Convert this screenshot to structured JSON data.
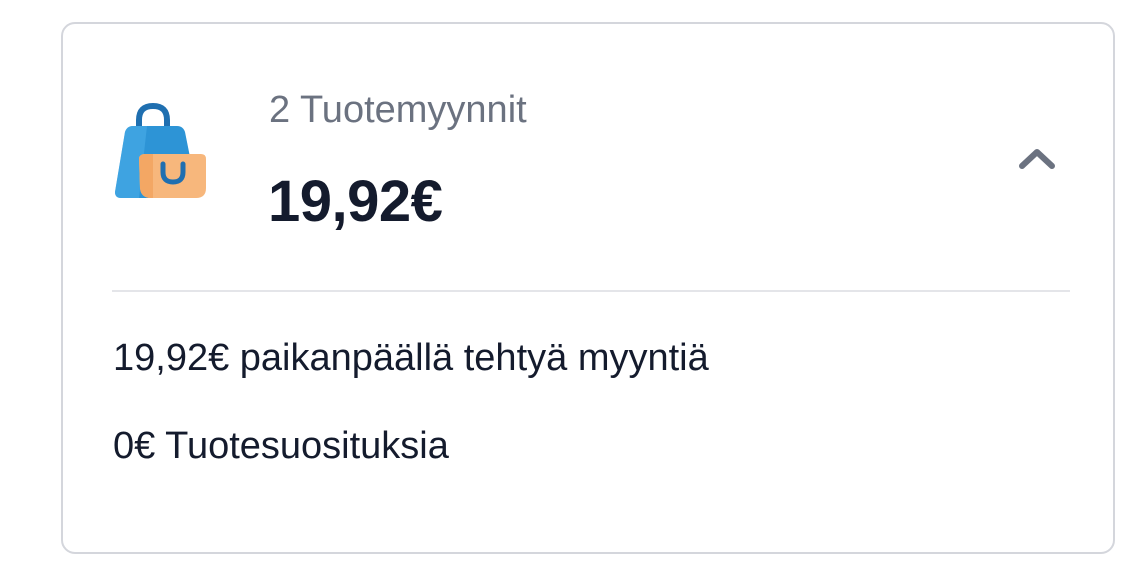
{
  "summary": {
    "title": "2 Tuotemyynnit",
    "amount": "19,92€",
    "icon": "shopping-bag-icon",
    "toggle_icon": "chevron-up-icon",
    "expanded": true
  },
  "details": [
    {
      "text": "19,92€ paikanpäällä tehtyä myyntiä"
    },
    {
      "text": "0€ Tuotesuosituksia"
    }
  ],
  "colors": {
    "border": "#d4d6dc",
    "title_text": "#6b7280",
    "amount_text": "#141b2d",
    "bag_blue": "#2d94d6",
    "bag_orange": "#f7b77c"
  }
}
